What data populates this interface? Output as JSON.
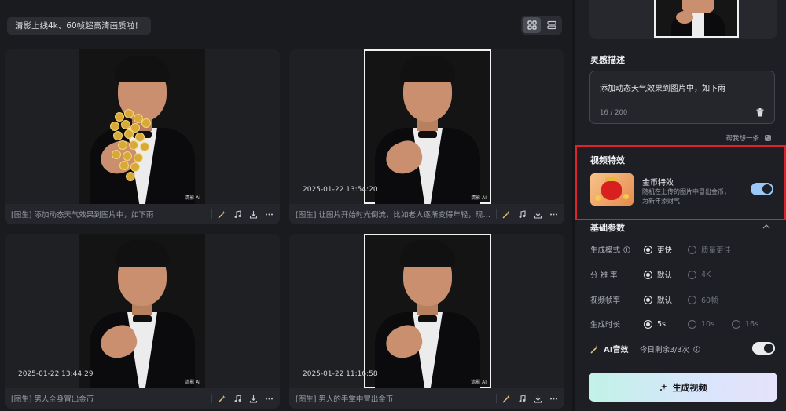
{
  "notice": "清影上线4k、60帧超高清画质啦！",
  "gallery": {
    "cards": [
      {
        "caption": "[图生] 添加动态天气效果到图片中，如下雨",
        "timestamp": "",
        "watermark": "清影 AI",
        "selected": false,
        "coins": true
      },
      {
        "caption": "[图生] 让图片开始时光倒流，比如老人逐渐变得年轻，现代建...",
        "timestamp": "2025-01-22 13:54:20",
        "watermark": "清影 AI",
        "selected": true,
        "coins": false
      },
      {
        "caption": "[图生] 男人全身冒出金币",
        "timestamp": "2025-01-22 13:44:29",
        "watermark": "清影 AI",
        "selected": false,
        "coins": false
      },
      {
        "caption": "[图生] 男人的手掌中冒出金币",
        "timestamp": "2025-01-22 11:16:58",
        "watermark": "清影 AI",
        "selected": true,
        "coins": false
      }
    ]
  },
  "panel": {
    "inspiration_title": "灵感描述",
    "prompt_text": "添加动态天气效果到图片中，如下雨",
    "prompt_count": "16 / 200",
    "help_text": "帮我想一条",
    "effects_title": "视频特效",
    "effect": {
      "name": "金币特效",
      "description": "随机在上传的图片中冒出金币，为新年添财气",
      "enabled": true
    },
    "params_title": "基础参数",
    "params": [
      {
        "label": "生成模式",
        "options": [
          "更快",
          "质量更佳"
        ],
        "selected": 0
      },
      {
        "label": "分 辨 率",
        "options": [
          "默认",
          "4K"
        ],
        "selected": 0
      },
      {
        "label": "视频帧率",
        "options": [
          "默认",
          "60帧"
        ],
        "selected": 0
      },
      {
        "label": "生成时长",
        "options": [
          "5s",
          "10s",
          "16s"
        ],
        "selected": 0
      }
    ],
    "ai_audio": {
      "label": "AI音效",
      "remaining": "今日剩余3/3次",
      "enabled": false
    },
    "generate_label": "生成视频"
  },
  "colors": {
    "accent_red": "#e2222b",
    "toggle_on": "#9cc8f5",
    "panel_bg": "#1d1f24"
  },
  "icons": [
    "grid-view-icon",
    "list-view-icon",
    "magic-wand-icon",
    "music-note-icon",
    "download-icon",
    "more-icon",
    "trash-icon",
    "sparkle-icon",
    "info-icon",
    "chevron-up-icon"
  ]
}
